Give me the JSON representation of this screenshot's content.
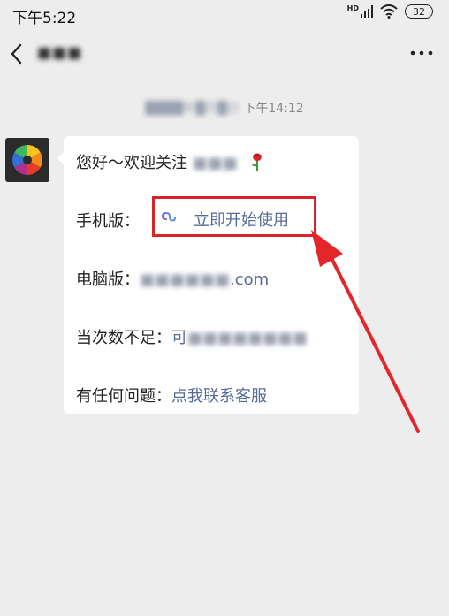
{
  "status_bar": {
    "time": "下午5:22",
    "hd_label": "HD",
    "battery": "32"
  },
  "nav": {
    "title": "■■■"
  },
  "chat": {
    "timestamp_prefix": "████年█月█日",
    "timestamp_time": " 下午14:12"
  },
  "message": {
    "greeting": "您好～欢迎关注",
    "greeting_blur": "■■■",
    "mobile_label": "手机版：",
    "mobile_link": "立即开始使用",
    "pc_label": "电脑版：",
    "pc_blur": "■■■■■■",
    "pc_suffix": ".com",
    "insufficient_label": "当次数不足：",
    "insufficient_prefix": "可",
    "insufficient_blur": "■■■■■■■■",
    "question_label": "有任何问题：",
    "question_link": "点我联系客服"
  },
  "icons": {
    "back": "chevron-left-icon",
    "more": "more-icon",
    "wifi": "wifi-icon",
    "signal": "signal-icon",
    "rose": "rose-icon",
    "mini_program": "link-icon"
  },
  "colors": {
    "background": "#ededed",
    "bubble": "#ffffff",
    "link": "#576b95",
    "highlight": "#d8232a"
  }
}
